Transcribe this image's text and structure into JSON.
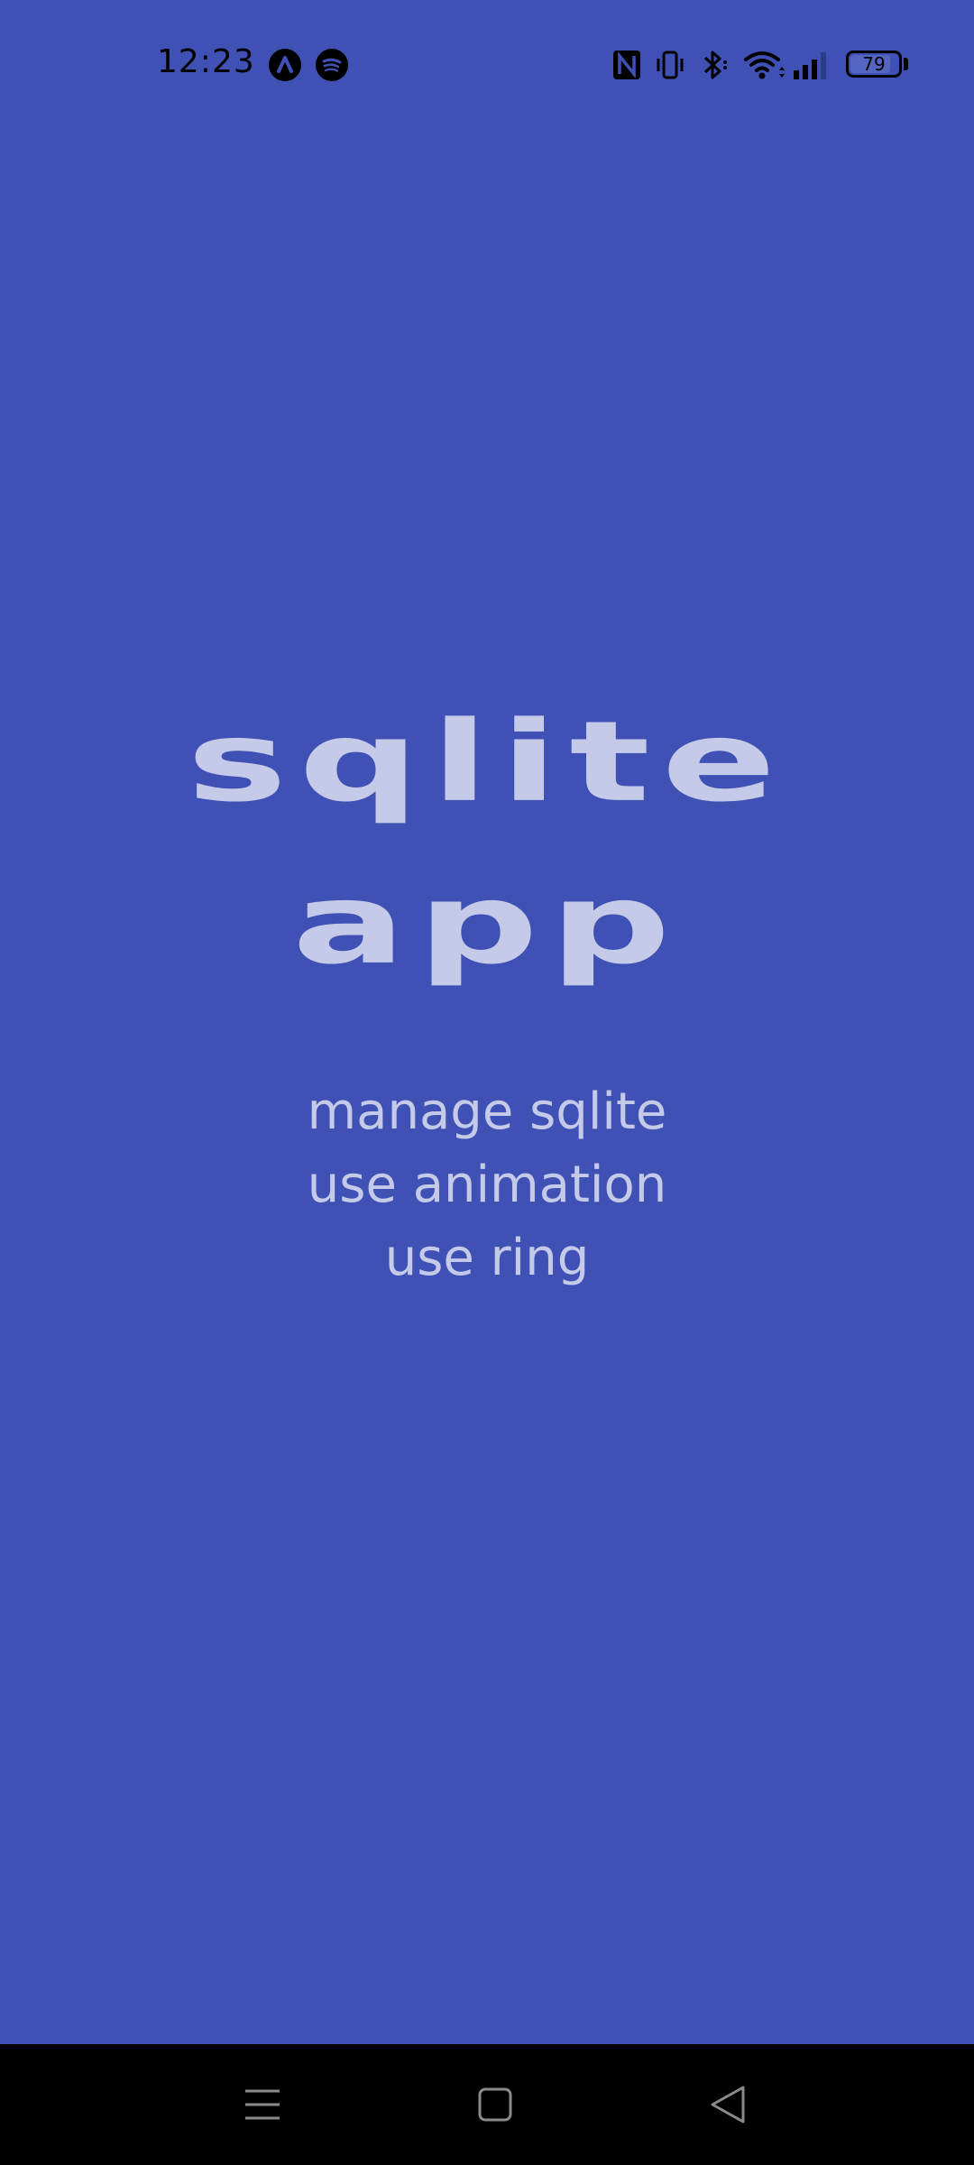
{
  "status_bar": {
    "time": "12:23",
    "battery_level": "79",
    "icons": [
      "app-a-icon",
      "spotify-icon",
      "nfc-icon",
      "vibrate-icon",
      "bluetooth-icon",
      "wifi-icon",
      "signal-icon",
      "battery-icon"
    ]
  },
  "main": {
    "title_line1": "sqlite",
    "title_line2": "app",
    "features": [
      "manage sqlite",
      "use animation",
      "use ring"
    ]
  },
  "nav_bar": {
    "buttons": [
      "menu-icon",
      "home-icon",
      "back-icon"
    ]
  },
  "colors": {
    "background": "#3f51b5",
    "text": "#c5cae9",
    "nav_background": "#000000"
  }
}
